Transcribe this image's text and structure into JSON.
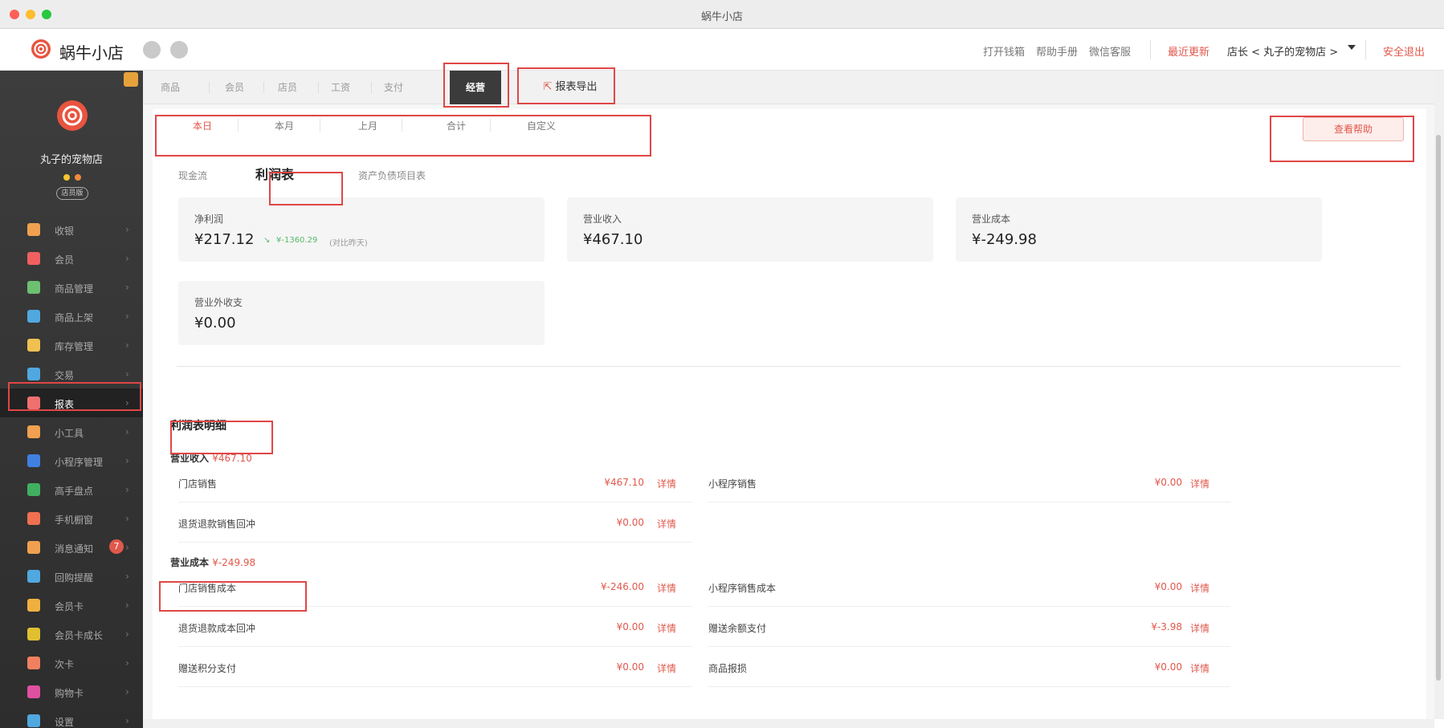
{
  "window": {
    "title": "蜗牛小店"
  },
  "header": {
    "app_name": "蜗牛小店",
    "links": [
      "打开钱箱",
      "帮助手册",
      "微信客服"
    ],
    "recent_update": "最近更新",
    "store_selector": "店长 < 丸子的宠物店 >",
    "logout": "安全退出"
  },
  "sidebar": {
    "shop_name": "丸子的宠物店",
    "pill": "店员版",
    "items": [
      {
        "label": "收银",
        "color": "#f0a050"
      },
      {
        "label": "会员",
        "color": "#f06060"
      },
      {
        "label": "商品管理",
        "color": "#6cc070"
      },
      {
        "label": "商品上架",
        "color": "#50a8e0"
      },
      {
        "label": "库存管理",
        "color": "#f0c050"
      },
      {
        "label": "交易",
        "color": "#50a8e0"
      },
      {
        "label": "报表",
        "color": "#f07070"
      },
      {
        "label": "小工具",
        "color": "#f0a050"
      },
      {
        "label": "小程序管理",
        "color": "#4080e0"
      },
      {
        "label": "高手盘点",
        "color": "#40b060"
      },
      {
        "label": "手机橱窗",
        "color": "#f07050"
      },
      {
        "label": "消息通知",
        "color": "#f0a050",
        "badge": "7"
      },
      {
        "label": "回购提醒",
        "color": "#50a8e0"
      },
      {
        "label": "会员卡",
        "color": "#f0b040"
      },
      {
        "label": "会员卡成长",
        "color": "#e0c030"
      },
      {
        "label": "次卡",
        "color": "#f08060"
      },
      {
        "label": "购物卡",
        "color": "#e050a0"
      },
      {
        "label": "设置",
        "color": "#50a8e0"
      }
    ]
  },
  "topnav": {
    "tabs": [
      "商品",
      "会员",
      "店员",
      "工资",
      "支付",
      "经营"
    ],
    "export": "报表导出"
  },
  "periods": [
    "本日",
    "本月",
    "上月",
    "合计",
    "自定义"
  ],
  "help_button": "查看帮助",
  "subtabs": [
    "现金流",
    "利润表",
    "资产负债项目表"
  ],
  "cards": [
    {
      "title": "净利润",
      "value": "¥217.12",
      "delta": "¥-1360.29",
      "compare": "(对比昨天)"
    },
    {
      "title": "营业收入",
      "value": "¥467.10"
    },
    {
      "title": "营业成本",
      "value": "¥-249.98"
    },
    {
      "title": "营业外收支",
      "value": "¥0.00"
    }
  ],
  "detail": {
    "title": "利润表明细",
    "revenue": {
      "label": "营业收入",
      "amount": "¥467.10",
      "rows": [
        {
          "label": "门店销售",
          "value": "¥467.10",
          "link": "详情"
        },
        {
          "label": "小程序销售",
          "value": "¥0.00",
          "link": "详情"
        },
        {
          "label": "退货退款销售回冲",
          "value": "¥0.00",
          "link": "详情"
        }
      ]
    },
    "cost": {
      "label": "营业成本",
      "amount": "¥-249.98",
      "rows": [
        {
          "label": "门店销售成本",
          "value": "¥-246.00",
          "link": "详情"
        },
        {
          "label": "小程序销售成本",
          "value": "¥0.00",
          "link": "详情"
        },
        {
          "label": "退货退款成本回冲",
          "value": "¥0.00",
          "link": "详情"
        },
        {
          "label": "赠送余额支付",
          "value": "¥-3.98",
          "link": "详情"
        },
        {
          "label": "赠送积分支付",
          "value": "¥0.00",
          "link": "详情"
        },
        {
          "label": "商品报损",
          "value": "¥0.00",
          "link": "详情"
        }
      ]
    }
  }
}
